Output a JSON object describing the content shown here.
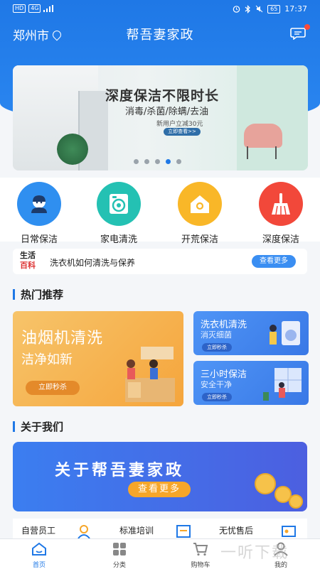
{
  "status_bar": {
    "left_chips": [
      "HD",
      "4G"
    ],
    "battery": "65",
    "time": "17:37"
  },
  "header": {
    "city": "郑州市",
    "title": "帮吾妻家政"
  },
  "banner": {
    "headline": "深度保洁不限时长",
    "sub": "消毒/杀菌/除螨/去油",
    "promo": "新用户立减30元",
    "button": "立即查看>>",
    "page_count": 5,
    "active_index": 3
  },
  "categories": [
    {
      "label": "日常保洁",
      "icon": "cleaner-person-icon",
      "color": "#2f8ff0"
    },
    {
      "label": "家电清洗",
      "icon": "washing-machine-icon",
      "color": "#24c1b3"
    },
    {
      "label": "开荒保洁",
      "icon": "house-icon",
      "color": "#f9b728"
    },
    {
      "label": "深度保洁",
      "icon": "broom-icon",
      "color": "#f2483a"
    }
  ],
  "tips": {
    "logo_top": "生活",
    "logo_bottom": "百科",
    "text": "洗衣机如何清洗与保养",
    "button": "查看更多"
  },
  "hot": {
    "section_title": "热门推荐",
    "big": {
      "title": "油烟机清洗",
      "sub": "洁净如新",
      "button": "立即秒杀"
    },
    "small": [
      {
        "title": "洗衣机清洗",
        "sub": "消灭细菌",
        "button": "立即秒杀"
      },
      {
        "title": "三小时保洁",
        "sub": "安全干净",
        "button": "立即秒杀"
      }
    ]
  },
  "about": {
    "section_title": "关于我们",
    "title": "关于帮吾妻家政",
    "button": "查看更多"
  },
  "features": [
    "自营员工",
    "标准培训",
    "无忧售后"
  ],
  "tabs": [
    {
      "label": "首页",
      "icon": "home-icon",
      "active": true
    },
    {
      "label": "分类",
      "icon": "grid-icon",
      "active": false
    },
    {
      "label": "购物车",
      "icon": "cart-icon",
      "active": false
    },
    {
      "label": "我的",
      "icon": "user-icon",
      "active": false
    }
  ],
  "watermark": "一听下载",
  "colors": {
    "primary": "#1f78e6",
    "accent_orange": "#f6a629"
  }
}
